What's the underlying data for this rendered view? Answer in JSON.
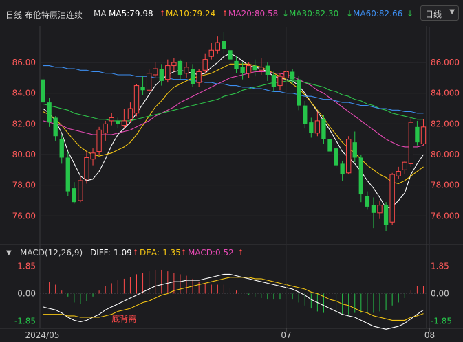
{
  "header": {
    "title": "日线 布伦特原油连续",
    "ma_label": "MA",
    "ma5": "MA5:79.98",
    "ma10": "MA10:79.24",
    "ma20": "MA20:80.58",
    "ma30": "MA30:82.30",
    "ma60": "MA60:82.66",
    "period": "日线"
  },
  "indicator": {
    "name": "MACD(12,26,9)",
    "diff": "DIFF:-1.09",
    "dea": "DEA:-1.35",
    "macd": "MACD:0.52",
    "annotation": "底背离"
  },
  "colors": {
    "up": "#ff4a4a",
    "down": "#26c44a",
    "ma5": "#ffffff",
    "ma10": "#f2c414",
    "ma20": "#e64ab4",
    "ma30": "#2ec44a",
    "ma60": "#3d8ef0"
  },
  "chart_data": {
    "type": "candlestick",
    "y_ticks": [
      "86.000",
      "84.000",
      "82.000",
      "80.000",
      "78.000",
      "76.000"
    ],
    "y_ticks_left": [
      "86.000",
      "84.000",
      "82.000",
      "80.000",
      "78.000",
      "76.000"
    ],
    "ylim": [
      74.4,
      88.2
    ],
    "x_labels": [
      {
        "label": "2024/05",
        "index": 0
      },
      {
        "label": "07",
        "index": 39
      },
      {
        "label": "08",
        "index": 62
      }
    ],
    "candles": [
      [
        84.9,
        83.4,
        85.1,
        83.0
      ],
      [
        83.4,
        82.1,
        83.7,
        81.8
      ],
      [
        82.4,
        81.2,
        82.5,
        80.9
      ],
      [
        81.0,
        79.8,
        81.3,
        79.4
      ],
      [
        79.8,
        77.6,
        80.2,
        77.3
      ],
      [
        77.8,
        76.9,
        78.2,
        76.8
      ],
      [
        77.0,
        78.3,
        78.6,
        76.9
      ],
      [
        78.4,
        79.8,
        80.2,
        78.1
      ],
      [
        79.7,
        80.1,
        80.4,
        79.3
      ],
      [
        80.2,
        81.6,
        81.8,
        80.0
      ],
      [
        81.4,
        82.0,
        82.2,
        80.9
      ],
      [
        82.2,
        82.4,
        82.7,
        81.9
      ],
      [
        82.2,
        82.0,
        82.4,
        81.7
      ],
      [
        81.9,
        82.2,
        83.0,
        81.7
      ],
      [
        82.3,
        83.0,
        83.4,
        82.1
      ],
      [
        82.7,
        84.5,
        84.6,
        82.5
      ],
      [
        84.4,
        84.2,
        85.1,
        83.9
      ],
      [
        84.2,
        85.3,
        85.6,
        84.0
      ],
      [
        85.2,
        85.6,
        86.0,
        85.0
      ],
      [
        85.6,
        84.8,
        85.9,
        84.5
      ],
      [
        84.9,
        85.8,
        86.2,
        84.7
      ],
      [
        85.8,
        86.0,
        86.3,
        85.4
      ],
      [
        86.1,
        85.2,
        86.2,
        84.9
      ],
      [
        85.3,
        85.7,
        86.0,
        85.0
      ],
      [
        85.6,
        84.6,
        85.9,
        84.4
      ],
      [
        84.7,
        85.4,
        85.6,
        84.4
      ],
      [
        85.5,
        86.2,
        86.6,
        85.3
      ],
      [
        86.4,
        86.8,
        87.3,
        86.2
      ],
      [
        86.8,
        87.3,
        87.7,
        86.6
      ],
      [
        87.4,
        86.9,
        88.0,
        86.6
      ],
      [
        86.8,
        86.2,
        87.1,
        85.9
      ],
      [
        86.1,
        85.6,
        86.4,
        85.3
      ],
      [
        85.7,
        85.3,
        86.0,
        84.9
      ],
      [
        85.3,
        85.8,
        86.0,
        85.0
      ],
      [
        85.8,
        85.5,
        86.2,
        85.1
      ],
      [
        85.5,
        85.7,
        86.3,
        85.2
      ],
      [
        85.8,
        85.2,
        86.0,
        84.8
      ],
      [
        85.2,
        84.4,
        85.4,
        84.1
      ],
      [
        84.5,
        85.1,
        85.3,
        84.2
      ],
      [
        85.0,
        85.4,
        85.9,
        84.6
      ],
      [
        85.4,
        84.9,
        85.6,
        84.6
      ],
      [
        84.9,
        83.2,
        85.1,
        82.9
      ],
      [
        83.2,
        82.0,
        83.5,
        81.7
      ],
      [
        82.1,
        81.4,
        82.4,
        81.1
      ],
      [
        81.4,
        82.2,
        82.8,
        81.2
      ],
      [
        82.3,
        81.0,
        82.6,
        80.7
      ],
      [
        81.0,
        80.2,
        81.5,
        80.0
      ],
      [
        80.4,
        79.3,
        80.6,
        79.1
      ],
      [
        79.4,
        78.7,
        79.6,
        78.3
      ],
      [
        78.8,
        81.0,
        81.2,
        78.7
      ],
      [
        80.8,
        79.8,
        81.5,
        79.5
      ],
      [
        79.8,
        77.4,
        80.0,
        76.9
      ],
      [
        77.3,
        76.6,
        77.6,
        76.4
      ],
      [
        76.7,
        76.2,
        77.2,
        75.2
      ],
      [
        76.2,
        76.7,
        77.0,
        75.8
      ],
      [
        76.7,
        75.4,
        76.9,
        75.0
      ],
      [
        75.6,
        78.7,
        78.8,
        75.4
      ],
      [
        78.6,
        78.9,
        79.2,
        78.4
      ],
      [
        79.0,
        79.5,
        79.6,
        78.7
      ],
      [
        79.4,
        82.1,
        82.4,
        79.2
      ],
      [
        81.8,
        80.8,
        82.2,
        80.6
      ],
      [
        80.7,
        81.8,
        82.3,
        80.6
      ]
    ],
    "series": [
      {
        "name": "MA5",
        "key": "ma5",
        "values": [
          83.0,
          82.7,
          82.2,
          81.4,
          80.2,
          79.4,
          78.6,
          78.3,
          78.4,
          78.9,
          79.7,
          80.6,
          81.3,
          81.7,
          82.1,
          82.7,
          83.3,
          83.9,
          84.5,
          84.9,
          85.2,
          85.4,
          85.5,
          85.4,
          85.3,
          85.2,
          85.3,
          85.7,
          86.0,
          86.4,
          86.6,
          86.4,
          86.1,
          85.8,
          85.7,
          85.6,
          85.4,
          85.1,
          85.0,
          84.9,
          84.8,
          84.5,
          84.0,
          83.4,
          82.8,
          82.2,
          81.6,
          80.9,
          80.2,
          79.8,
          79.4,
          78.9,
          78.3,
          77.8,
          77.2,
          76.5,
          76.6,
          77.0,
          77.5,
          78.7,
          79.4,
          80.0
        ]
      },
      {
        "name": "MA10",
        "key": "ma10",
        "values": [
          82.8,
          82.6,
          82.3,
          81.9,
          81.4,
          80.9,
          80.5,
          80.2,
          80.0,
          79.9,
          80.0,
          80.1,
          80.3,
          80.5,
          80.8,
          81.3,
          81.9,
          82.5,
          83.1,
          83.5,
          84.0,
          84.4,
          84.6,
          84.8,
          85.0,
          85.1,
          85.2,
          85.3,
          85.5,
          85.7,
          85.9,
          85.9,
          85.9,
          85.9,
          85.8,
          85.7,
          85.5,
          85.3,
          85.1,
          84.9,
          84.6,
          84.3,
          83.9,
          83.4,
          82.9,
          82.4,
          81.8,
          81.3,
          80.8,
          80.4,
          80.1,
          79.7,
          79.3,
          79.0,
          78.7,
          78.5,
          78.2,
          78.1,
          78.3,
          78.6,
          78.9,
          79.2
        ]
      },
      {
        "name": "MA20",
        "key": "ma20",
        "values": [
          82.2,
          82.1,
          82.0,
          81.9,
          81.7,
          81.6,
          81.5,
          81.4,
          81.3,
          81.3,
          81.3,
          81.3,
          81.4,
          81.5,
          81.6,
          81.8,
          82.0,
          82.2,
          82.5,
          82.7,
          82.9,
          83.1,
          83.4,
          83.6,
          83.8,
          84.0,
          84.2,
          84.4,
          84.6,
          84.8,
          85.0,
          85.1,
          85.2,
          85.3,
          85.4,
          85.4,
          85.4,
          85.3,
          85.3,
          85.2,
          85.1,
          84.9,
          84.7,
          84.5,
          84.2,
          84.0,
          83.7,
          83.4,
          83.1,
          82.8,
          82.5,
          82.2,
          81.9,
          81.6,
          81.3,
          81.0,
          80.8,
          80.6,
          80.5,
          80.5,
          80.5,
          80.6
        ]
      },
      {
        "name": "MA30",
        "key": "ma30",
        "values": [
          83.3,
          83.2,
          83.1,
          83.0,
          82.9,
          82.7,
          82.6,
          82.5,
          82.4,
          82.3,
          82.3,
          82.2,
          82.2,
          82.2,
          82.2,
          82.3,
          82.4,
          82.5,
          82.6,
          82.7,
          82.8,
          82.9,
          83.0,
          83.1,
          83.2,
          83.3,
          83.4,
          83.5,
          83.6,
          83.8,
          83.9,
          84.0,
          84.2,
          84.3,
          84.4,
          84.5,
          84.6,
          84.7,
          84.7,
          84.8,
          84.8,
          84.8,
          84.7,
          84.6,
          84.5,
          84.4,
          84.2,
          84.1,
          83.9,
          83.8,
          83.6,
          83.5,
          83.3,
          83.2,
          83.0,
          82.9,
          82.7,
          82.6,
          82.5,
          82.4,
          82.3,
          82.3
        ]
      },
      {
        "name": "MA60",
        "key": "ma60",
        "values": [
          85.8,
          85.8,
          85.7,
          85.7,
          85.6,
          85.6,
          85.5,
          85.5,
          85.4,
          85.4,
          85.3,
          85.3,
          85.2,
          85.2,
          85.2,
          85.1,
          85.1,
          85.1,
          85.0,
          85.0,
          85.0,
          84.9,
          84.9,
          84.9,
          84.8,
          84.8,
          84.7,
          84.7,
          84.6,
          84.6,
          84.5,
          84.5,
          84.4,
          84.4,
          84.3,
          84.3,
          84.2,
          84.1,
          84.1,
          84.0,
          84.0,
          83.9,
          83.8,
          83.8,
          83.7,
          83.6,
          83.6,
          83.5,
          83.4,
          83.4,
          83.3,
          83.2,
          83.2,
          83.1,
          83.0,
          83.0,
          82.9,
          82.9,
          82.8,
          82.8,
          82.7,
          82.7
        ]
      }
    ],
    "macd": {
      "y_ticks": [
        "1.85",
        "0.00",
        "-1.85"
      ],
      "ylim": [
        -2.2,
        2.2
      ],
      "diff": [
        -0.9,
        -1.0,
        -1.1,
        -1.3,
        -1.6,
        -1.8,
        -1.9,
        -1.8,
        -1.6,
        -1.4,
        -1.1,
        -0.9,
        -0.7,
        -0.5,
        -0.3,
        -0.1,
        0.1,
        0.3,
        0.5,
        0.6,
        0.7,
        0.8,
        0.8,
        0.9,
        0.9,
        0.9,
        1.0,
        1.1,
        1.2,
        1.3,
        1.3,
        1.2,
        1.1,
        1.0,
        0.9,
        0.8,
        0.7,
        0.6,
        0.5,
        0.4,
        0.3,
        0.1,
        -0.1,
        -0.4,
        -0.6,
        -0.8,
        -1.0,
        -1.2,
        -1.4,
        -1.5,
        -1.6,
        -1.8,
        -2.0,
        -2.2,
        -2.3,
        -2.4,
        -2.3,
        -2.2,
        -2.0,
        -1.7,
        -1.4,
        -1.1
      ],
      "dea": [
        -1.4,
        -1.4,
        -1.4,
        -1.4,
        -1.5,
        -1.5,
        -1.6,
        -1.6,
        -1.6,
        -1.6,
        -1.5,
        -1.4,
        -1.2,
        -1.1,
        -1.0,
        -0.8,
        -0.6,
        -0.5,
        -0.3,
        -0.1,
        0.0,
        0.2,
        0.3,
        0.4,
        0.5,
        0.6,
        0.7,
        0.8,
        0.9,
        1.0,
        1.1,
        1.1,
        1.1,
        1.1,
        1.0,
        1.0,
        0.9,
        0.8,
        0.7,
        0.6,
        0.5,
        0.4,
        0.3,
        0.1,
        0.0,
        -0.2,
        -0.4,
        -0.5,
        -0.7,
        -0.8,
        -1.0,
        -1.2,
        -1.3,
        -1.5,
        -1.6,
        -1.7,
        -1.8,
        -1.8,
        -1.8,
        -1.6,
        -1.5,
        -1.35
      ],
      "hist": [
        0.95,
        0.8,
        0.6,
        0.2,
        -0.2,
        -0.6,
        -0.7,
        -0.5,
        -0.2,
        0.2,
        0.5,
        0.7,
        0.9,
        1.0,
        1.1,
        1.3,
        1.4,
        1.5,
        1.6,
        1.6,
        1.5,
        1.4,
        1.3,
        1.2,
        1.0,
        0.8,
        0.7,
        0.6,
        0.6,
        0.6,
        0.4,
        0.2,
        0.0,
        -0.1,
        -0.2,
        -0.3,
        -0.4,
        -0.4,
        -0.4,
        -0.4,
        -0.4,
        -0.6,
        -0.8,
        -1.0,
        -1.2,
        -1.3,
        -1.3,
        -1.4,
        -1.4,
        -1.4,
        -1.3,
        -1.3,
        -1.3,
        -1.3,
        -1.2,
        -1.1,
        -0.8,
        -0.6,
        -0.3,
        0.2,
        0.5,
        0.52
      ]
    }
  }
}
